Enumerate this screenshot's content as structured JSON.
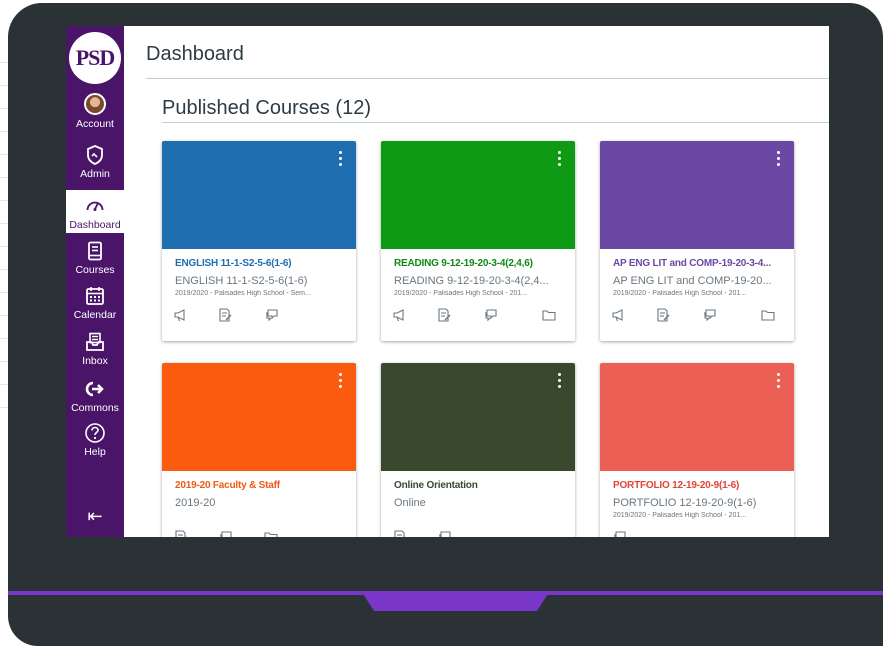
{
  "screen": {
    "title": "Dashboard",
    "section_title": "Published Courses (12)"
  },
  "nav": {
    "logo": "PSD",
    "items": [
      {
        "label": "Account",
        "icon": "avatar"
      },
      {
        "label": "Admin",
        "icon": "shield-icon"
      },
      {
        "label": "Dashboard",
        "icon": "speedometer-icon",
        "active": true
      },
      {
        "label": "Courses",
        "icon": "book-icon"
      },
      {
        "label": "Calendar",
        "icon": "calendar-icon"
      },
      {
        "label": "Inbox",
        "icon": "inbox-icon"
      },
      {
        "label": "Commons",
        "icon": "arrow-right-icon"
      },
      {
        "label": "Help",
        "icon": "question-icon"
      }
    ],
    "collapse_icon": "collapse-icon",
    "colors": {
      "nav_bg": "#4a1569",
      "accent": "#7a35c9"
    }
  },
  "courses": [
    {
      "title": "ENGLISH 11-1-S2-5-6(1-6)",
      "code": "ENGLISH 11-1-S2-5-6(1-6)",
      "term": "2019/2020 - Palisades High School - Sem...",
      "color": "#1f6fb0",
      "title_color": "#1f6fb0",
      "actions": [
        "announcement-icon",
        "assignment-icon",
        "discussion-icon"
      ]
    },
    {
      "title": "READING 9-12-19-20-3-4(2,4,6)",
      "code": "READING 9-12-19-20-3-4(2,4...",
      "term": "2019/2020 - Palisades High School - 201...",
      "color": "#0e9a14",
      "title_color": "#0e8a14",
      "actions": [
        "announcement-icon",
        "assignment-icon",
        "discussion-icon",
        "folder-icon"
      ]
    },
    {
      "title": "AP ENG LIT and COMP-19-20-3-4...",
      "code": "AP ENG LIT and COMP-19-20...",
      "term": "2019/2020 - Palisades High School - 201...",
      "color": "#6a48a3",
      "title_color": "#6a48a3",
      "actions": [
        "announcement-icon",
        "assignment-icon",
        "discussion-icon",
        "folder-icon"
      ]
    },
    {
      "title": "2019-20 Faculty & Staff",
      "code": "2019-20",
      "term": "",
      "color": "#fb5b0e",
      "title_color": "#f05a14",
      "actions": [
        "assignment-icon",
        "discussion-icon",
        "folder-icon"
      ]
    },
    {
      "title": "Online Orientation",
      "code": "Online",
      "term": "",
      "color": "#39492d",
      "title_color": "#39492d",
      "actions": [
        "assignment-icon",
        "discussion-icon"
      ]
    },
    {
      "title": "PORTFOLIO 12-19-20-9(1-6)",
      "code": "PORTFOLIO 12-19-20-9(1-6)",
      "term": "2019/2020 - Palisades High School - 201...",
      "color": "#ec5f55",
      "title_color": "#e0443a",
      "actions": [
        "discussion-icon"
      ]
    }
  ]
}
